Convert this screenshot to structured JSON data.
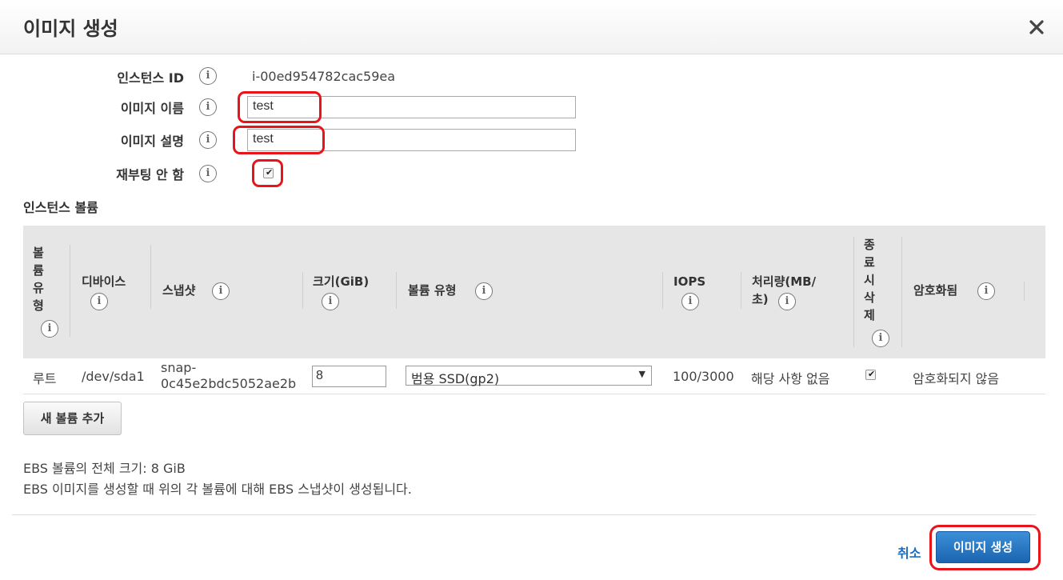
{
  "dialog": {
    "title": "이미지 생성",
    "close_icon": "close-icon"
  },
  "form": {
    "instance_id_label": "인스턴스 ID",
    "instance_id_value": "i-00ed954782cac59ea",
    "image_name_label": "이미지 이름",
    "image_name_value": "test",
    "image_desc_label": "이미지 설명",
    "image_desc_value": "test",
    "no_reboot_label": "재부팅 안 함",
    "no_reboot_checked": true,
    "info_glyph": "i"
  },
  "volumes": {
    "section_title": "인스턴스 볼륨",
    "columns": {
      "volume_type_vertical": [
        "볼",
        "륨",
        "유",
        "형"
      ],
      "device": "디바이스",
      "snapshot": "스냅샷",
      "size": "크기(GiB)",
      "volume_type": "볼륨 유형",
      "iops": "IOPS",
      "throughput_line1": "처리량(MB/",
      "throughput_line2": "초)",
      "delete_vertical": [
        "종",
        "료",
        "시",
        "삭",
        "제"
      ],
      "encrypted": "암호화됨"
    },
    "rows": [
      {
        "type": "루트",
        "device": "/dev/sda1",
        "snapshot_line1": "snap-",
        "snapshot_line2": "0c45e2bdc5052ae2b",
        "size": "8",
        "volume_type": "범용 SSD(gp2)",
        "iops": "100/3000",
        "throughput": "해당 사항 없음",
        "delete_on_termination": true,
        "encrypted": "암호화되지 않음"
      }
    ],
    "add_button": "새 볼륨 추가"
  },
  "notes": {
    "total_size": "EBS 볼륨의 전체 크기: 8 GiB",
    "snapshot_note": "EBS 이미지를 생성할 때 위의 각 볼륨에 대해 EBS 스냅샷이 생성됩니다."
  },
  "footer": {
    "cancel": "취소",
    "create": "이미지 생성"
  },
  "colors": {
    "primary": "#1b64b0",
    "link": "#1a6fc2",
    "highlight": "#e8141b",
    "header_bg": "#e6e6e6"
  }
}
